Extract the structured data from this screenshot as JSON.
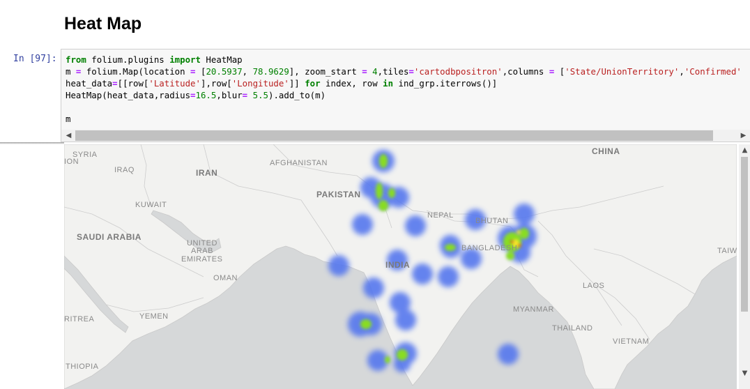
{
  "heading": "Heat Map",
  "cell": {
    "prompt": "In [97]:",
    "code_lines": [
      "from folium.plugins import HeatMap",
      "m = folium.Map(location = [20.5937, 78.9629], zoom_start = 4,tiles='cartodbpositron',columns = ['State/UnionTerritory','Confirmed'",
      "heat_data=[[row['Latitude'],row['Longitude']] for index, row in ind_grp.iterrows()]",
      "HeatMap(heat_data,radius=16.5,blur= 5.5).add_to(m)",
      "",
      "m"
    ]
  },
  "map": {
    "labels": {
      "syria": "SYRIA",
      "lebanon": "ION",
      "iraq": "IRAQ",
      "iran": "IRAN",
      "afghanistan": "AFGHANISTAN",
      "china": "CHINA",
      "pakistan": "PAKISTAN",
      "kuwait": "KUWAIT",
      "nepal": "NEPAL",
      "bhutan": "BHUTAN",
      "saudi_arabia": "SAUDI ARABIA",
      "uae_1": "UNITED",
      "uae_2": "ARAB",
      "uae_3": "EMIRATES",
      "bangladesh": "BANGLADESH",
      "taiwan": "TAIW",
      "india": "INDIA",
      "oman": "OMAN",
      "laos": "LAOS",
      "myanmar": "MYANMAR",
      "eritrea": "RITREA",
      "yemen": "YEMEN",
      "thailand": "THAILAND",
      "vietnam": "VIETNAM",
      "ethiopia": "THIOPIA"
    },
    "colors": {
      "land": "#f2f2f0",
      "water": "#d4d6d8",
      "border": "#c9c9c9",
      "blue": "#5577ee",
      "green": "#88dd22",
      "yellow": "#f5ec2a",
      "red": "#ee3322"
    }
  }
}
